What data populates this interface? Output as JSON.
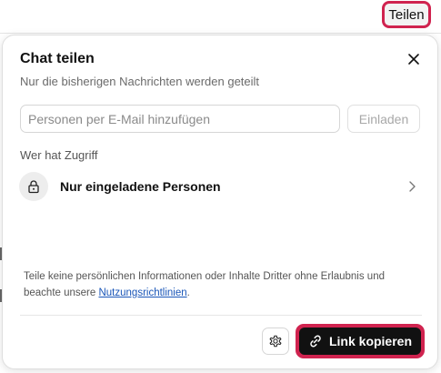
{
  "topbar": {
    "share_label": "Teilen"
  },
  "dialog": {
    "title": "Chat teilen",
    "subtitle": "Nur die bisherigen Nachrichten werden geteilt",
    "email_input": {
      "placeholder": "Personen per E-Mail hinzufügen",
      "value": ""
    },
    "invite_label": "Einladen",
    "access_heading": "Wer hat Zugriff",
    "access_option": "Nur eingeladene Personen",
    "disclaimer_prefix": "Teile keine persönlichen Informationen oder Inhalte Dritter ohne Erlaubnis und beachte unsere ",
    "disclaimer_link": "Nutzungsrichtlinien",
    "disclaimer_suffix": ".",
    "copy_link_label": "Link kopieren"
  },
  "icons": {
    "close": "close-icon",
    "lock": "lock-icon",
    "chevron": "chevron-right-icon",
    "settings": "gear-icon",
    "link": "link-icon"
  },
  "colors": {
    "highlight": "#d0234f",
    "primary_button": "#111111",
    "link": "#1a56b8"
  }
}
